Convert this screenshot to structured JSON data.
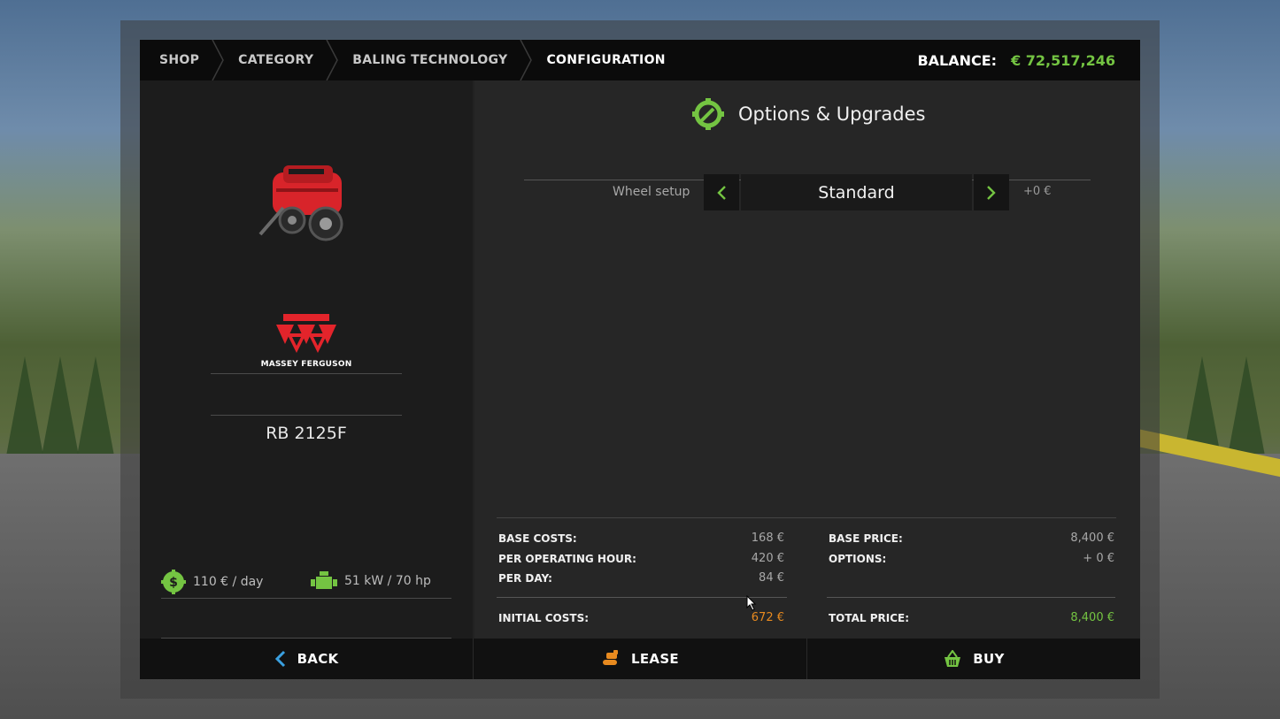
{
  "breadcrumb": [
    "SHOP",
    "CATEGORY",
    "BALING TECHNOLOGY",
    "CONFIGURATION"
  ],
  "balance": {
    "label": "BALANCE:",
    "value": "€ 72,517,246"
  },
  "vehicle": {
    "brand": "MASSEY FERGUSON",
    "model": "RB 2125F",
    "specs": {
      "daily_cost": "110 € / day",
      "power": "51 kW / 70 hp"
    }
  },
  "options": {
    "title": "Options & Upgrades",
    "wheel_setup": {
      "label": "Wheel setup",
      "value": "Standard",
      "price": "+0 €"
    }
  },
  "costs": {
    "base_costs": {
      "label": "BASE COSTS:",
      "value": "168 €"
    },
    "per_operating_hour": {
      "label": "PER OPERATING HOUR:",
      "value": "420 €"
    },
    "per_day": {
      "label": "PER DAY:",
      "value": "84 €"
    },
    "initial_costs": {
      "label": "INITIAL COSTS:",
      "value": "672 €"
    },
    "base_price": {
      "label": "BASE PRICE:",
      "value": "8,400 €"
    },
    "options": {
      "label": "OPTIONS:",
      "value": "+ 0 €"
    },
    "total_price": {
      "label": "TOTAL PRICE:",
      "value": "8,400 €"
    }
  },
  "footer": {
    "back": "BACK",
    "lease": "LEASE",
    "buy": "BUY"
  },
  "colors": {
    "accent": "#74c442",
    "orange": "#e88a1f",
    "back_arrow": "#3aa0e0",
    "brand_red": "#e3242b"
  }
}
